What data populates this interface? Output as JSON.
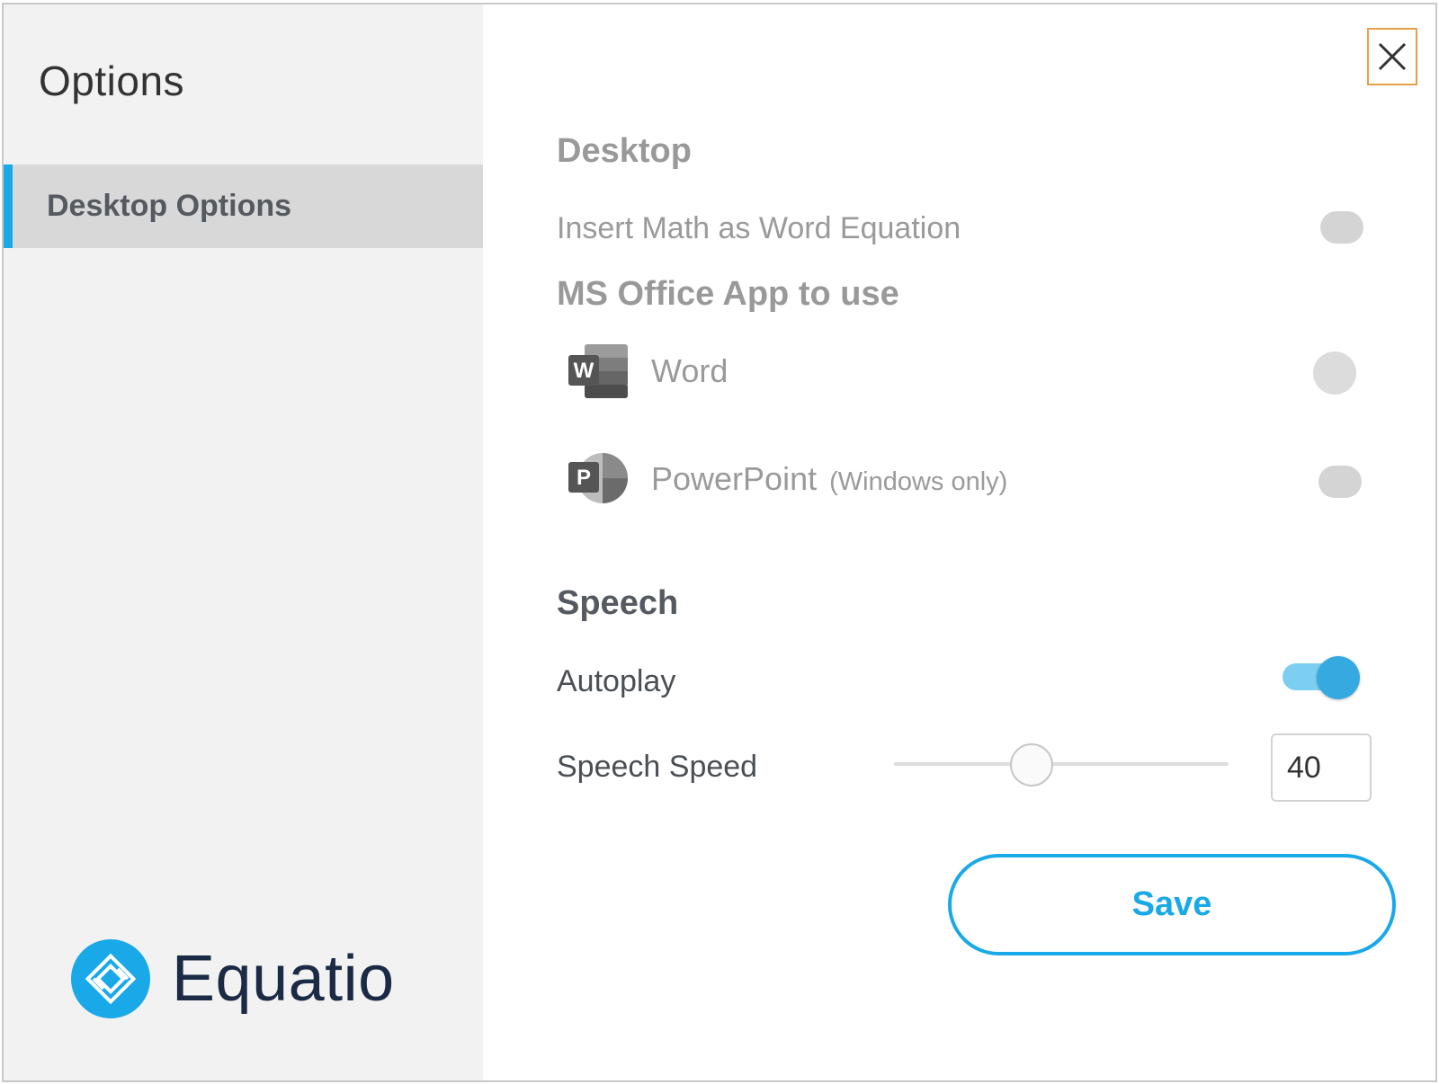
{
  "sidebar": {
    "title": "Options",
    "items": [
      {
        "label": "Desktop Options",
        "active": true
      }
    ],
    "brand": {
      "name": "Equatio"
    }
  },
  "main": {
    "desktop": {
      "heading": "Desktop",
      "insert_math_label": "Insert Math as Word Equation",
      "insert_math_enabled": false
    },
    "ms_office": {
      "heading": "MS Office App to use",
      "apps": [
        {
          "label": "Word",
          "note": "",
          "icon": "word-icon",
          "selected": false
        },
        {
          "label": "PowerPoint",
          "note": "(Windows only)",
          "icon": "powerpoint-icon",
          "selected": false
        }
      ]
    },
    "speech": {
      "heading": "Speech",
      "autoplay_label": "Autoplay",
      "autoplay_enabled": true,
      "speed_label": "Speech Speed",
      "speed_value": "40",
      "speed_fraction": 0.41
    },
    "save_label": "Save"
  },
  "colors": {
    "accent": "#1aa9e8",
    "toggle_on": "#36a9e1",
    "close_border": "#e8a046",
    "brand_text": "#1c2b45"
  }
}
